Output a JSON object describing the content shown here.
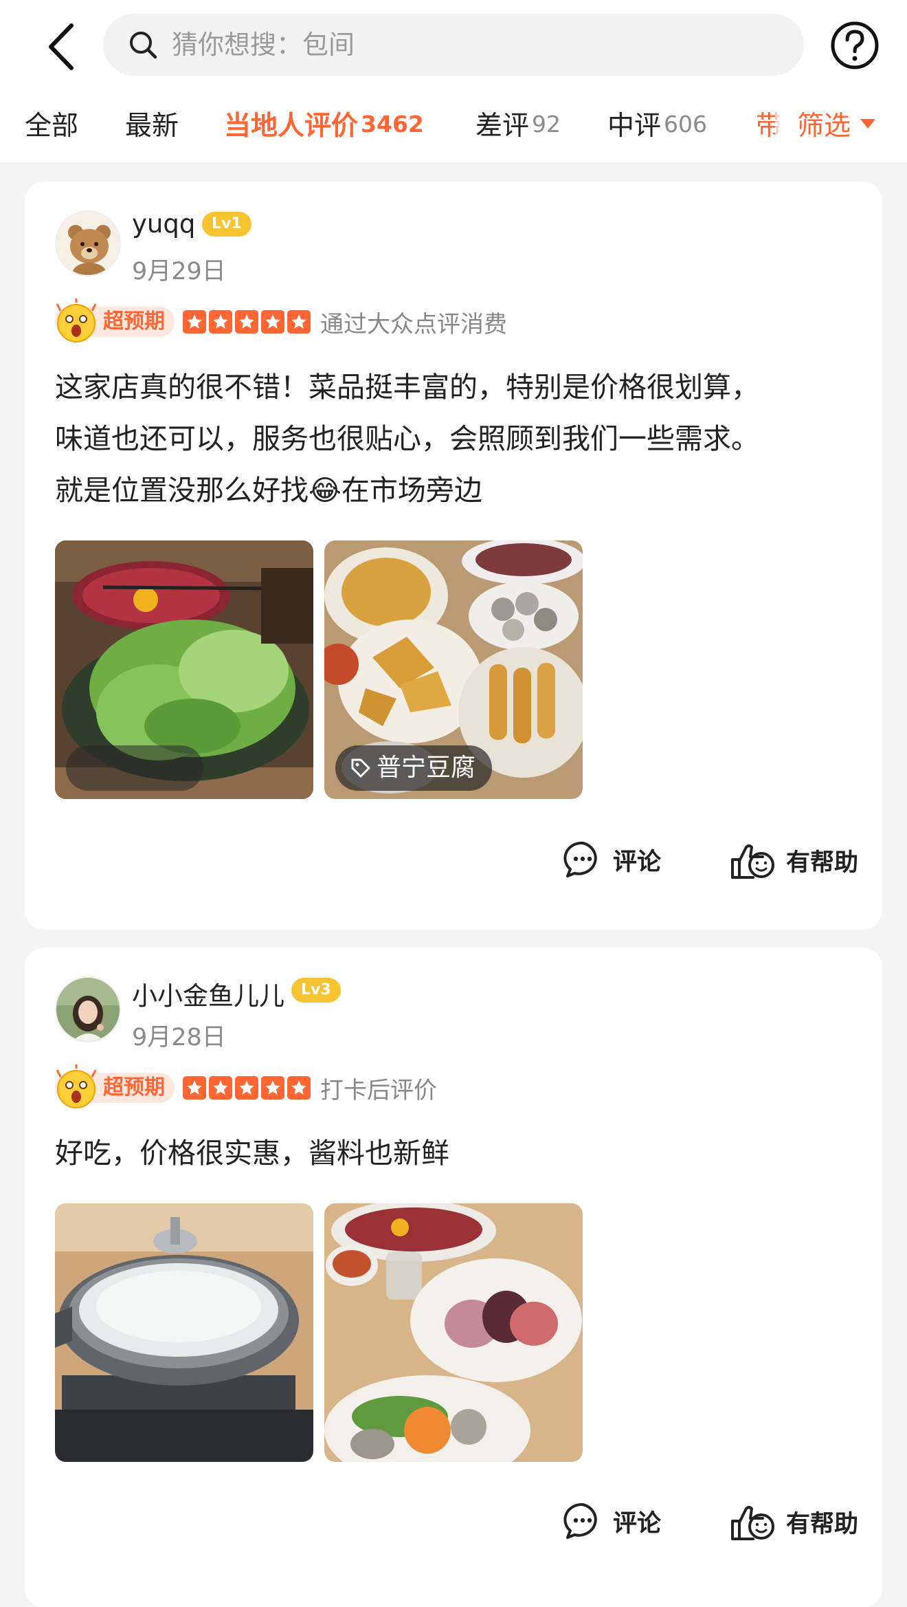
{
  "search": {
    "placeholder": "猜你想搜：包间"
  },
  "tabs": [
    {
      "label": "全部"
    },
    {
      "label": "最新"
    },
    {
      "label": "当地人评价",
      "count": "3462"
    },
    {
      "label": "差评",
      "count": "92"
    },
    {
      "label": "中评",
      "count": "606"
    },
    {
      "label": "带"
    }
  ],
  "filter": {
    "label": "筛选"
  },
  "reviews": [
    {
      "username": "yuqq",
      "level": "Lv1",
      "date": "9月29日",
      "exceed_label": "超预期",
      "stars": 5,
      "source": "通过大众点评消费",
      "text": [
        "这家店真的很不错！菜品挺丰富的，特别是价格很划算，",
        "味道也还可以，服务也很贴心，会照顾到我们一些需求。",
        "就是位置没那么好找😂在市场旁边"
      ],
      "photo_tag": "普宁豆腐",
      "comment_label": "评论",
      "helpful_label": "有帮助"
    },
    {
      "username": "小小金鱼儿儿",
      "level": "Lv3",
      "date": "9月28日",
      "exceed_label": "超预期",
      "stars": 5,
      "source": "打卡后评价",
      "text": [
        "好吃，价格很实惠，酱料也新鲜"
      ],
      "comment_label": "评论",
      "helpful_label": "有帮助"
    }
  ],
  "colors": {
    "accent": "#ff6633",
    "level_badge": "#f7c431",
    "background": "#f4f4f4"
  }
}
